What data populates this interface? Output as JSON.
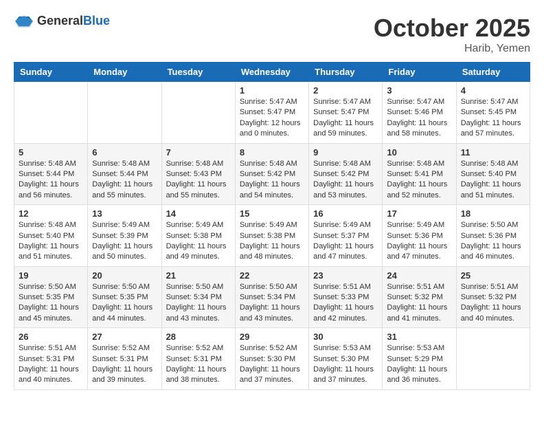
{
  "header": {
    "logo_general": "General",
    "logo_blue": "Blue",
    "month": "October 2025",
    "location": "Harib, Yemen"
  },
  "weekdays": [
    "Sunday",
    "Monday",
    "Tuesday",
    "Wednesday",
    "Thursday",
    "Friday",
    "Saturday"
  ],
  "weeks": [
    [
      {
        "day": "",
        "info": ""
      },
      {
        "day": "",
        "info": ""
      },
      {
        "day": "",
        "info": ""
      },
      {
        "day": "1",
        "info": "Sunrise: 5:47 AM\nSunset: 5:47 PM\nDaylight: 12 hours\nand 0 minutes."
      },
      {
        "day": "2",
        "info": "Sunrise: 5:47 AM\nSunset: 5:47 PM\nDaylight: 11 hours\nand 59 minutes."
      },
      {
        "day": "3",
        "info": "Sunrise: 5:47 AM\nSunset: 5:46 PM\nDaylight: 11 hours\nand 58 minutes."
      },
      {
        "day": "4",
        "info": "Sunrise: 5:47 AM\nSunset: 5:45 PM\nDaylight: 11 hours\nand 57 minutes."
      }
    ],
    [
      {
        "day": "5",
        "info": "Sunrise: 5:48 AM\nSunset: 5:44 PM\nDaylight: 11 hours\nand 56 minutes."
      },
      {
        "day": "6",
        "info": "Sunrise: 5:48 AM\nSunset: 5:44 PM\nDaylight: 11 hours\nand 55 minutes."
      },
      {
        "day": "7",
        "info": "Sunrise: 5:48 AM\nSunset: 5:43 PM\nDaylight: 11 hours\nand 55 minutes."
      },
      {
        "day": "8",
        "info": "Sunrise: 5:48 AM\nSunset: 5:42 PM\nDaylight: 11 hours\nand 54 minutes."
      },
      {
        "day": "9",
        "info": "Sunrise: 5:48 AM\nSunset: 5:42 PM\nDaylight: 11 hours\nand 53 minutes."
      },
      {
        "day": "10",
        "info": "Sunrise: 5:48 AM\nSunset: 5:41 PM\nDaylight: 11 hours\nand 52 minutes."
      },
      {
        "day": "11",
        "info": "Sunrise: 5:48 AM\nSunset: 5:40 PM\nDaylight: 11 hours\nand 51 minutes."
      }
    ],
    [
      {
        "day": "12",
        "info": "Sunrise: 5:48 AM\nSunset: 5:40 PM\nDaylight: 11 hours\nand 51 minutes."
      },
      {
        "day": "13",
        "info": "Sunrise: 5:49 AM\nSunset: 5:39 PM\nDaylight: 11 hours\nand 50 minutes."
      },
      {
        "day": "14",
        "info": "Sunrise: 5:49 AM\nSunset: 5:38 PM\nDaylight: 11 hours\nand 49 minutes."
      },
      {
        "day": "15",
        "info": "Sunrise: 5:49 AM\nSunset: 5:38 PM\nDaylight: 11 hours\nand 48 minutes."
      },
      {
        "day": "16",
        "info": "Sunrise: 5:49 AM\nSunset: 5:37 PM\nDaylight: 11 hours\nand 47 minutes."
      },
      {
        "day": "17",
        "info": "Sunrise: 5:49 AM\nSunset: 5:36 PM\nDaylight: 11 hours\nand 47 minutes."
      },
      {
        "day": "18",
        "info": "Sunrise: 5:50 AM\nSunset: 5:36 PM\nDaylight: 11 hours\nand 46 minutes."
      }
    ],
    [
      {
        "day": "19",
        "info": "Sunrise: 5:50 AM\nSunset: 5:35 PM\nDaylight: 11 hours\nand 45 minutes."
      },
      {
        "day": "20",
        "info": "Sunrise: 5:50 AM\nSunset: 5:35 PM\nDaylight: 11 hours\nand 44 minutes."
      },
      {
        "day": "21",
        "info": "Sunrise: 5:50 AM\nSunset: 5:34 PM\nDaylight: 11 hours\nand 43 minutes."
      },
      {
        "day": "22",
        "info": "Sunrise: 5:50 AM\nSunset: 5:34 PM\nDaylight: 11 hours\nand 43 minutes."
      },
      {
        "day": "23",
        "info": "Sunrise: 5:51 AM\nSunset: 5:33 PM\nDaylight: 11 hours\nand 42 minutes."
      },
      {
        "day": "24",
        "info": "Sunrise: 5:51 AM\nSunset: 5:32 PM\nDaylight: 11 hours\nand 41 minutes."
      },
      {
        "day": "25",
        "info": "Sunrise: 5:51 AM\nSunset: 5:32 PM\nDaylight: 11 hours\nand 40 minutes."
      }
    ],
    [
      {
        "day": "26",
        "info": "Sunrise: 5:51 AM\nSunset: 5:31 PM\nDaylight: 11 hours\nand 40 minutes."
      },
      {
        "day": "27",
        "info": "Sunrise: 5:52 AM\nSunset: 5:31 PM\nDaylight: 11 hours\nand 39 minutes."
      },
      {
        "day": "28",
        "info": "Sunrise: 5:52 AM\nSunset: 5:31 PM\nDaylight: 11 hours\nand 38 minutes."
      },
      {
        "day": "29",
        "info": "Sunrise: 5:52 AM\nSunset: 5:30 PM\nDaylight: 11 hours\nand 37 minutes."
      },
      {
        "day": "30",
        "info": "Sunrise: 5:53 AM\nSunset: 5:30 PM\nDaylight: 11 hours\nand 37 minutes."
      },
      {
        "day": "31",
        "info": "Sunrise: 5:53 AM\nSunset: 5:29 PM\nDaylight: 11 hours\nand 36 minutes."
      },
      {
        "day": "",
        "info": ""
      }
    ]
  ]
}
